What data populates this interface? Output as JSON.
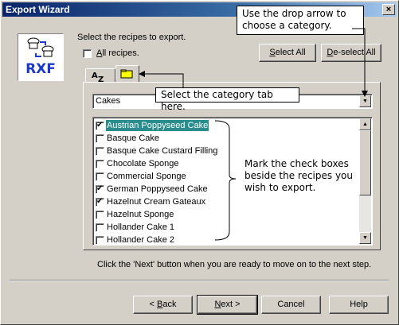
{
  "window": {
    "title": "Export Wizard",
    "close_label": "×"
  },
  "logo": {
    "text": "RXF"
  },
  "prompt": "Select the recipes to export.",
  "all_recipes": {
    "label": "All recipes.",
    "checked": false
  },
  "buttons": {
    "select_all": "Select All",
    "deselect_all": "De-select All",
    "back": "< Back",
    "next": "Next >",
    "cancel": "Cancel",
    "help": "Help"
  },
  "tabs": [
    {
      "icon": "sort-az-icon",
      "label": "AZ"
    },
    {
      "icon": "folder-icon",
      "label": ""
    }
  ],
  "category": {
    "selected": "Cakes"
  },
  "recipes": [
    {
      "name": "Austrian Poppyseed Cake",
      "checked": true,
      "selected": true
    },
    {
      "name": "Basque Cake",
      "checked": false,
      "selected": false
    },
    {
      "name": "Basque Cake Custard Filling",
      "checked": false,
      "selected": false
    },
    {
      "name": "Chocolate Sponge",
      "checked": false,
      "selected": false
    },
    {
      "name": "Commercial Sponge",
      "checked": false,
      "selected": false
    },
    {
      "name": "German Poppyseed Cake",
      "checked": true,
      "selected": false
    },
    {
      "name": "Hazelnut Cream Gateaux",
      "checked": true,
      "selected": false
    },
    {
      "name": "Hazelnut Sponge",
      "checked": false,
      "selected": false
    },
    {
      "name": "Hollander Cake 1",
      "checked": false,
      "selected": false
    },
    {
      "name": "Hollander Cake 2",
      "checked": false,
      "selected": false
    }
  ],
  "callouts": {
    "dropdown": [
      "Use the drop arrow to",
      "choose a category."
    ],
    "tab": "Select the category tab here.",
    "checkboxes": [
      "Mark the check boxes",
      "beside the recipes you",
      "wish to export."
    ]
  },
  "next_hint": "Click the 'Next' button when you are ready to move on to the next step.",
  "colors": {
    "title_start": "#0a246a",
    "selection": "#2a8c8c",
    "logo": "#1c39c8"
  }
}
